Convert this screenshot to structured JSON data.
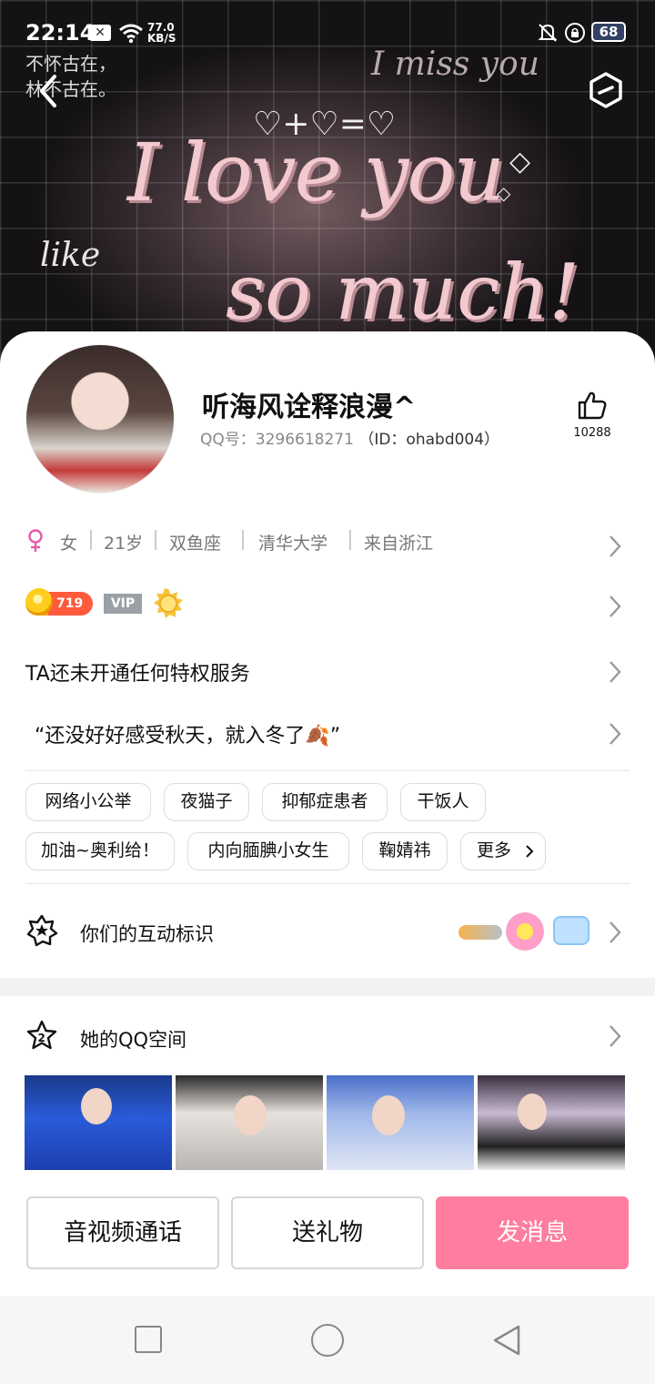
{
  "status_bar": {
    "time": "22:14",
    "speed_value": "77.0",
    "speed_unit": "KB/S",
    "battery": "68"
  },
  "banner": {
    "text_main": "I love you",
    "text_much": "so much!",
    "text_miss": "I miss you",
    "text_like": "like",
    "text_hearts": "♡+♡=♡"
  },
  "profile": {
    "nickname": "听海风诠释浪漫^",
    "qq_label": "QQ号：3296618271",
    "id_label": "（ID：ohabd004）",
    "like_count": "10288"
  },
  "info": {
    "gender": "女",
    "age": "21岁",
    "zodiac": "双鱼座",
    "school": "清华大学",
    "hometown": "来自浙江"
  },
  "badges": {
    "level": "719",
    "vip": "VIP"
  },
  "privilege_text": "TA还未开通任何特权服务",
  "signature": "“还没好好感受秋天，就入冬了🍂”",
  "tags": [
    "网络小公举",
    "夜猫子",
    "抑郁症患者",
    "干饭人",
    "加油~奥利给！",
    "内向腼腆小女生",
    "鞠婧祎",
    "更多"
  ],
  "interaction_label": "你们的互动标识",
  "qzone_title": "她的QQ空间",
  "actions": {
    "call": "音视频通话",
    "gift": "送礼物",
    "message": "发消息"
  },
  "colors": {
    "accent_pink": "#ff7d9f",
    "gender_pink": "#e85aa8"
  }
}
